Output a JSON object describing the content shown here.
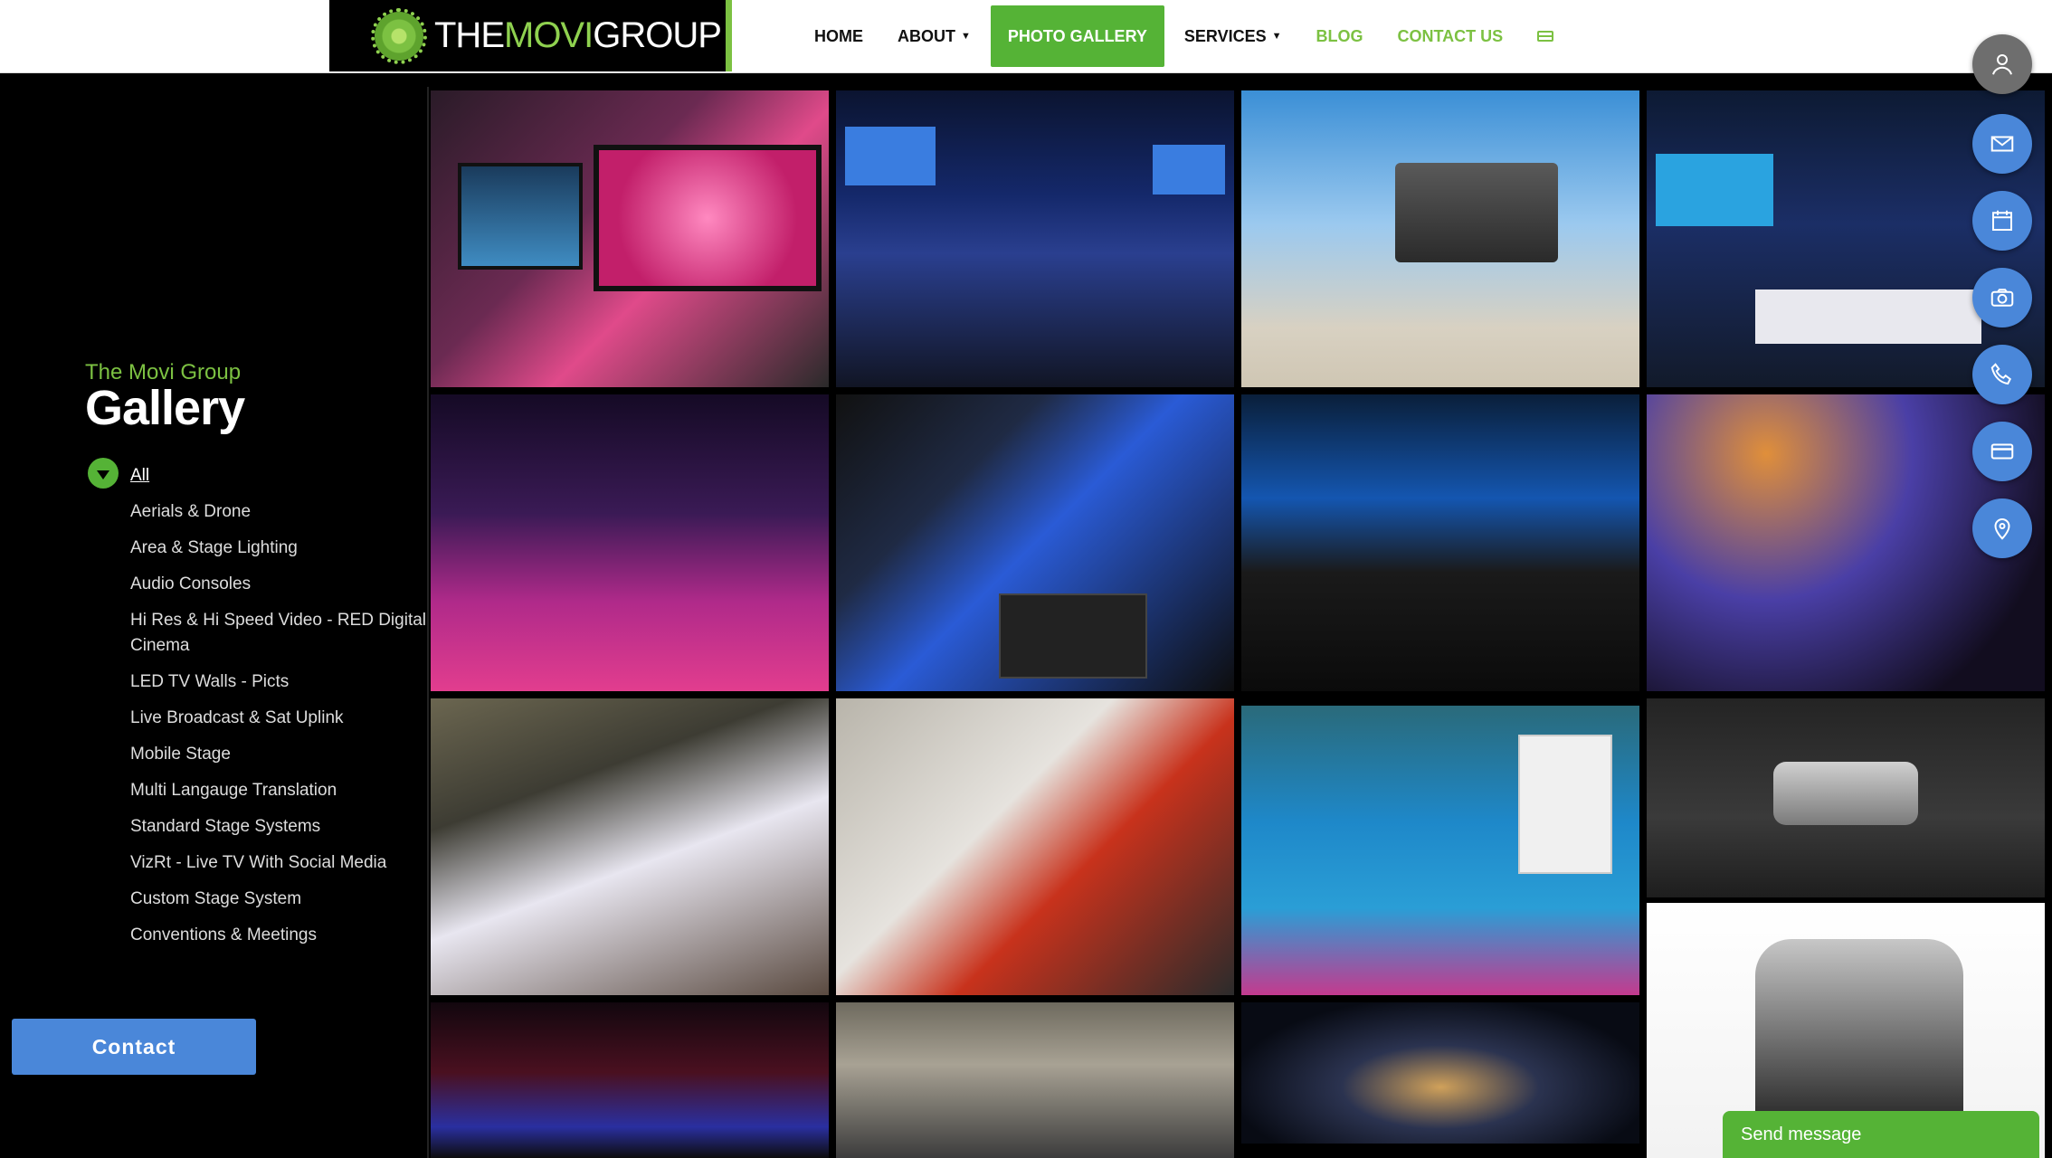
{
  "header": {
    "logo": {
      "text_the": "THE",
      "text_movi": "MOVI",
      "text_group": "GROUP"
    },
    "nav": [
      {
        "label": "HOME",
        "style": "normal"
      },
      {
        "label": "ABOUT",
        "style": "dropdown"
      },
      {
        "label": "PHOTO GALLERY",
        "style": "active"
      },
      {
        "label": "SERVICES",
        "style": "dropdown"
      },
      {
        "label": "BLOG",
        "style": "green"
      },
      {
        "label": "CONTACT US",
        "style": "green"
      }
    ],
    "nav_icon": "credit-card-icon"
  },
  "sidebar": {
    "brand": "The Movi Group",
    "title": "Gallery",
    "filters": [
      "All",
      "Aerials & Drone",
      "Area & Stage Lighting",
      "Audio Consoles",
      "Hi Res & Hi Speed Video - RED Digital Cinema",
      "LED TV Walls - Picts",
      "Live Broadcast & Sat Uplink",
      "Mobile Stage",
      "Multi Langauge Translation",
      "Standard Stage Systems",
      "VizRt - Live TV With Social Media",
      "Custom Stage System",
      "Conventions & Meetings"
    ],
    "active_filter": "All",
    "contact_button": "Contact"
  },
  "fabs": [
    "user-icon",
    "mail-icon",
    "calendar-icon",
    "camera-icon",
    "phone-icon",
    "credit-card-icon",
    "map-pin-icon"
  ],
  "chat": {
    "label": "Send message"
  },
  "colors": {
    "brand_green": "#7cc142",
    "active_green": "#55b336",
    "contact_blue": "#4a87d9"
  }
}
